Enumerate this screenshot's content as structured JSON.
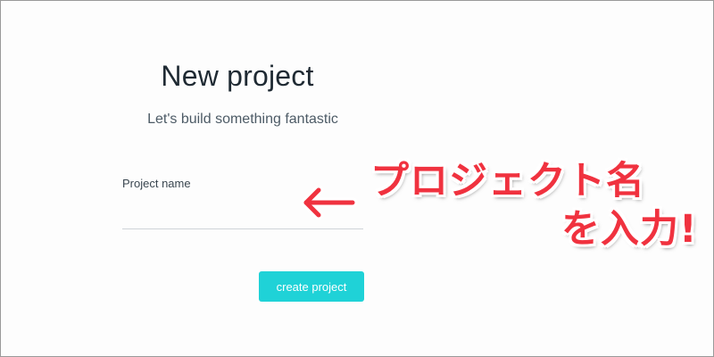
{
  "page": {
    "title": "New project",
    "subtitle": "Let's build something fantastic"
  },
  "form": {
    "project_name_label": "Project name",
    "project_name_value": "",
    "create_button_label": "create project",
    "accent_color": "#1fd2d7"
  },
  "annotation": {
    "arrow_icon": "left-arrow-icon",
    "line1": "プロジェクト名",
    "line2": "を入力!",
    "color": "#f0323f"
  }
}
